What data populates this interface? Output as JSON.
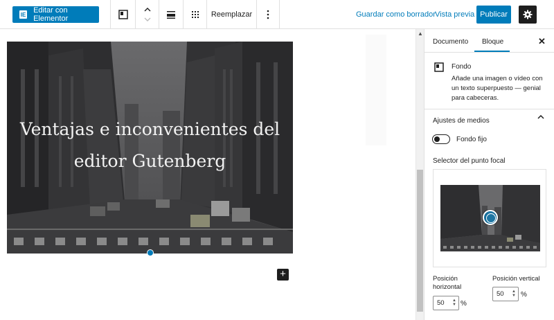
{
  "toolbar": {
    "elementor_label": "Editar con Elementor",
    "replace_label": "Reemplazar",
    "save_draft_label": "Guardar como borrador",
    "preview_label": "Vista previa",
    "publish_label": "Publicar"
  },
  "cover": {
    "title": "Ventajas e inconvenientes del editor Gutenberg"
  },
  "sidebar": {
    "tabs": [
      {
        "label": "Documento"
      },
      {
        "label": "Bloque"
      }
    ],
    "block": {
      "name": "Fondo",
      "description": "Añade una imagen o vídeo con un texto superpuesto — genial para cabeceras."
    },
    "media_settings": {
      "title": "Ajustes de medios",
      "fixed_bg_label": "Fondo fijo",
      "fixed_bg_enabled": false,
      "focal_label": "Selector del punto focal",
      "horizontal_label": "Posición horizontal",
      "horizontal_value": "50",
      "vertical_label": "Posición vertical",
      "vertical_value": "50",
      "unit": "%"
    }
  },
  "colors": {
    "accent": "#007cba",
    "dark": "#1e1e1e"
  }
}
